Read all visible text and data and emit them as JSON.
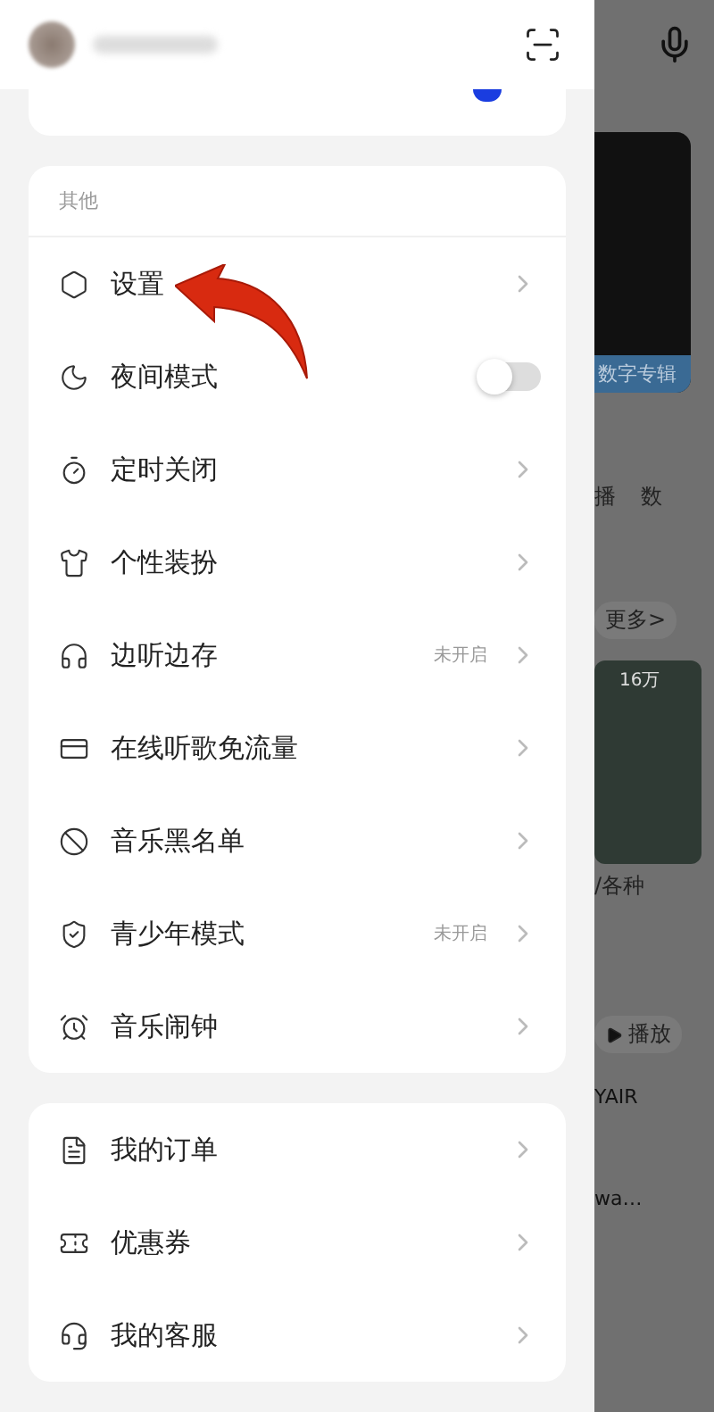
{
  "drawer": {
    "sections": [
      {
        "title": "其他",
        "items": [
          {
            "kind": "link",
            "label": "设置"
          },
          {
            "kind": "toggle",
            "label": "夜间模式",
            "on": false
          },
          {
            "kind": "link",
            "label": "定时关闭"
          },
          {
            "kind": "link",
            "label": "个性装扮"
          },
          {
            "kind": "link",
            "label": "边听边存",
            "status": "未开启"
          },
          {
            "kind": "link",
            "label": "在线听歌免流量"
          },
          {
            "kind": "link",
            "label": "音乐黑名单"
          },
          {
            "kind": "link",
            "label": "青少年模式",
            "status": "未开启"
          },
          {
            "kind": "link",
            "label": "音乐闹钟"
          }
        ]
      },
      {
        "items": [
          {
            "kind": "link",
            "label": "我的订单"
          },
          {
            "kind": "link",
            "label": "优惠券"
          },
          {
            "kind": "link",
            "label": "我的客服"
          }
        ]
      }
    ]
  },
  "background": {
    "album_caption": "数字专辑",
    "shortcuts": [
      "播",
      "数"
    ],
    "more": "更多>",
    "play_count": "16万",
    "playlist_title": "/各种",
    "play_button": "播放",
    "artist": "YAIR",
    "song": "wa…"
  }
}
